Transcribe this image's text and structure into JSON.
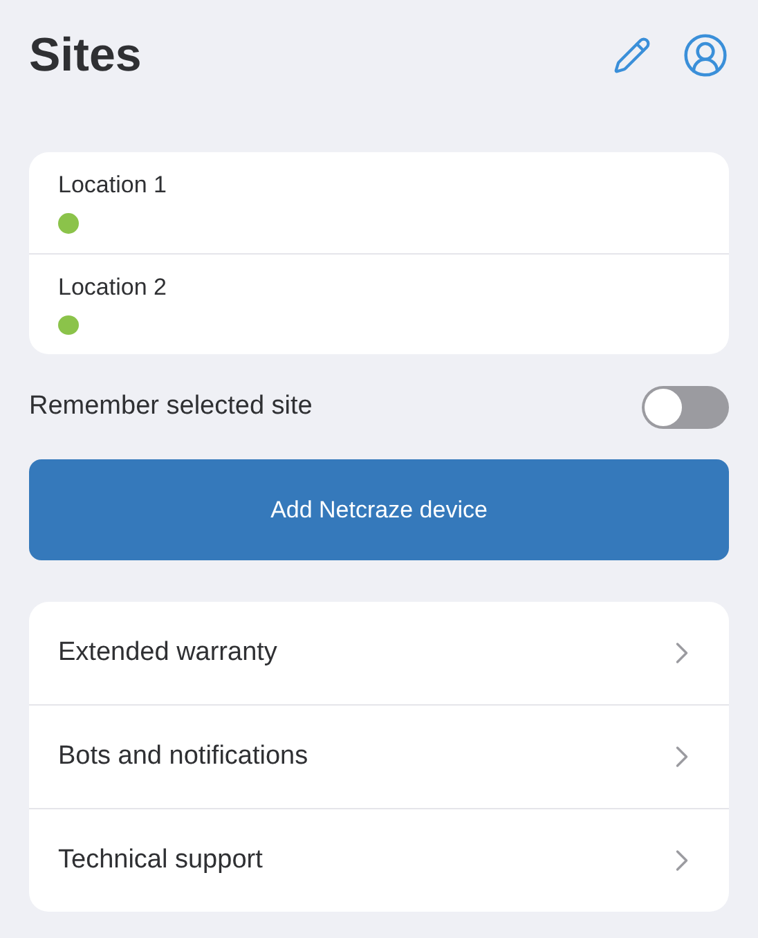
{
  "header": {
    "title": "Sites"
  },
  "sites": [
    {
      "name": "Location 1",
      "color": "#8bc34a"
    },
    {
      "name": "Location 2",
      "color": "#8bc34a"
    }
  ],
  "remember": {
    "label": "Remember selected site",
    "on": false
  },
  "add_button": "Add Netcraze device",
  "menu": [
    "Extended warranty",
    "Bots and notifications",
    "Technical support"
  ]
}
